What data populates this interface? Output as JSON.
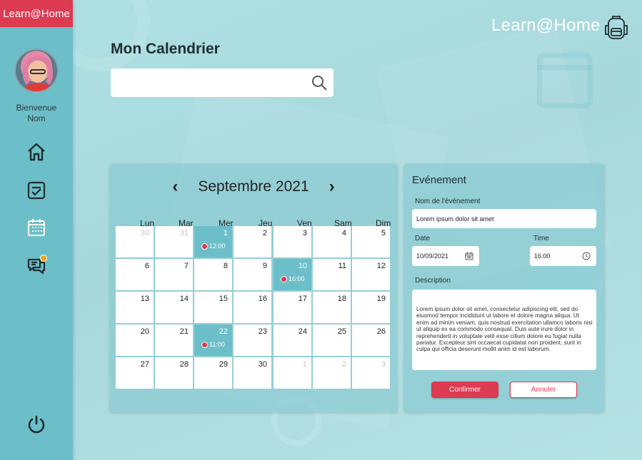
{
  "sidebar": {
    "logo": "Learn@Home",
    "welcome_line1": "Bienvenue",
    "welcome_line2": "Nom",
    "nav": [
      "home-icon",
      "tasks-icon",
      "calendar-icon",
      "chat-icon",
      "power-icon"
    ],
    "chat_badge_color": "#f3a516"
  },
  "header": {
    "brand": "Learn@Home",
    "page_title": "Mon Calendrier",
    "search_placeholder": ""
  },
  "calendar": {
    "month": "Septembre 2021",
    "prev": "‹",
    "next": "›",
    "weekdays": [
      "Lun",
      "Mar",
      "Mer",
      "Jeu",
      "Ven",
      "Sam",
      "Dim"
    ],
    "weeks": [
      [
        {
          "d": "30",
          "other": true
        },
        {
          "d": "31",
          "other": true
        },
        {
          "d": "1",
          "event": "12:00"
        },
        {
          "d": "2"
        },
        {
          "d": "3"
        },
        {
          "d": "4"
        },
        {
          "d": "5"
        }
      ],
      [
        {
          "d": "6"
        },
        {
          "d": "7"
        },
        {
          "d": "8"
        },
        {
          "d": "9"
        },
        {
          "d": "10",
          "event": "16:00"
        },
        {
          "d": "11"
        },
        {
          "d": "12"
        }
      ],
      [
        {
          "d": "13"
        },
        {
          "d": "14"
        },
        {
          "d": "15"
        },
        {
          "d": "16"
        },
        {
          "d": "17"
        },
        {
          "d": "18"
        },
        {
          "d": "19"
        }
      ],
      [
        {
          "d": "20"
        },
        {
          "d": "21"
        },
        {
          "d": "22",
          "event": "11:00"
        },
        {
          "d": "23"
        },
        {
          "d": "24"
        },
        {
          "d": "25"
        },
        {
          "d": "26"
        }
      ],
      [
        {
          "d": "27"
        },
        {
          "d": "28"
        },
        {
          "d": "29"
        },
        {
          "d": "30"
        },
        {
          "d": "1",
          "other": true
        },
        {
          "d": "2",
          "other": true
        },
        {
          "d": "3",
          "other": true
        }
      ]
    ]
  },
  "event_form": {
    "title": "Evénement",
    "name_label": "Nom de l'événement",
    "name_value": "Lorem ipsum dolor sit amet",
    "date_label": "Date",
    "date_value": "10/09/2021",
    "time_label": "Time",
    "time_value": "16:00",
    "description_label": "Description",
    "description_value": "Lorem ipsum dolor sit amet, consectetur adipiscing elit, sed do eiusmod tempor incididunt ut labore et dolore magna aliqua. Ut enim ad minim veniam, quis nostrud exercitation ullamco laboris nisi ut aliquip ex ea commodo consequat. Duis aute irure dolor in reprehenderit in voluptate velit esse cillum dolore eu fugiat nulla pariatur. Excepteur sint occaecat cupidatat non proident, sunt in culpa qui officia deserunt mollit anim id est laborum.",
    "confirm_label": "Confirmer",
    "cancel_label": "Annuler"
  },
  "colors": {
    "accent": "#dc3b51",
    "sidebar": "#6cbfc8",
    "event_cell": "#6cbfc8"
  }
}
